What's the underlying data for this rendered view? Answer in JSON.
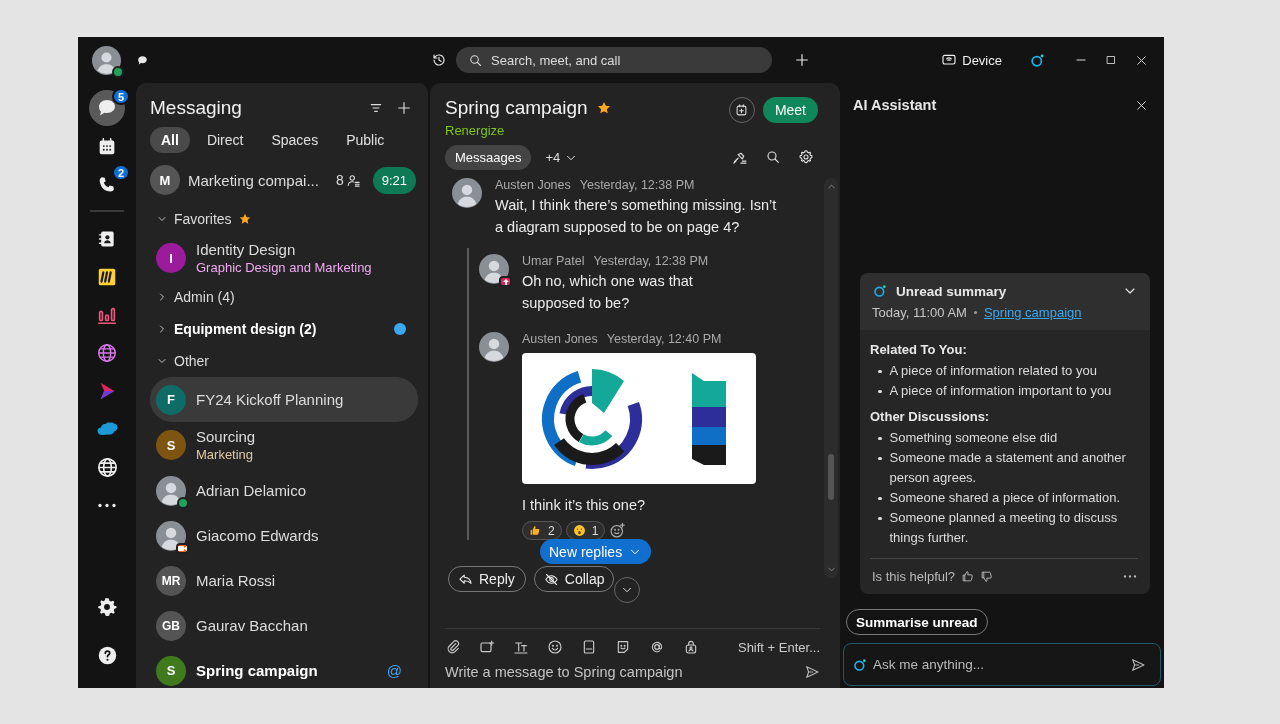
{
  "top_bar": {
    "user": {
      "status": {
        "kind": "available"
      }
    },
    "search": {
      "placeholder": "Search, meet, and call"
    },
    "device": "Device"
  },
  "rail": {
    "items": [
      {
        "kind": "messaging",
        "badge": "5",
        "selected": true
      },
      {
        "kind": "calendar",
        "selected": false
      },
      {
        "kind": "calls",
        "badge": "2",
        "selected": false
      },
      {
        "kind": "divider"
      },
      {
        "kind": "contacts",
        "selected": false
      },
      {
        "kind": "whiteboard",
        "selected": false
      },
      {
        "kind": "analytics",
        "selected": false
      },
      {
        "kind": "web",
        "selected": false
      },
      {
        "kind": "play",
        "selected": false
      },
      {
        "kind": "cloud",
        "selected": false
      },
      {
        "kind": "globe",
        "selected": false
      },
      {
        "kind": "more",
        "selected": false
      }
    ],
    "bottom": [
      {
        "kind": "settings"
      },
      {
        "kind": "help"
      }
    ]
  },
  "messaging": {
    "title": "Messaging",
    "filters": [
      {
        "label": "All",
        "selected": true
      },
      {
        "label": "Direct",
        "selected": false
      },
      {
        "label": "Spaces",
        "selected": false
      },
      {
        "label": "Public",
        "selected": false
      }
    ],
    "pinned": {
      "initials": "M",
      "name": "Marketing compai...",
      "count": "8",
      "time": "9:21"
    },
    "sections": [
      {
        "label": "Favorites",
        "expanded": true,
        "starred": true,
        "unread": false,
        "items": [
          {
            "kind": "initials",
            "initials": "I",
            "color": "#9c1a9c",
            "name": "Identity Design",
            "subtitle": "Graphic Design and Marketing",
            "selected": false,
            "unread": false
          }
        ]
      },
      {
        "label": "Admin (4)",
        "expanded": false,
        "starred": false,
        "unread": false
      },
      {
        "label": "Equipment design (2)",
        "expanded": false,
        "starred": false,
        "unread": true
      },
      {
        "label": "Other",
        "expanded": true,
        "starred": false,
        "unread": false,
        "items": [
          {
            "kind": "initials",
            "initials": "F",
            "color": "#0f6b66",
            "name": "FY24 Kickoff Planning",
            "selected": true,
            "unread": false
          },
          {
            "kind": "initials",
            "initials": "S",
            "color": "#7d5410",
            "name": "Sourcing",
            "subtitle": "Marketing",
            "selected": false,
            "unread": false
          },
          {
            "kind": "photo",
            "name": "Adrian Delamico",
            "status": {
              "kind": "available"
            },
            "selected": false,
            "unread": false
          },
          {
            "kind": "photo",
            "name": "Giacomo Edwards",
            "status": {
              "kind": "meeting"
            },
            "selected": false,
            "unread": false
          },
          {
            "kind": "initials",
            "initials": "MR",
            "color": "#545454",
            "name": "Maria Rossi",
            "selected": false,
            "unread": false
          },
          {
            "kind": "initials",
            "initials": "GB",
            "color": "#545454",
            "name": "Gaurav Bacchan",
            "selected": false,
            "unread": false
          },
          {
            "kind": "initials",
            "initials": "S",
            "color": "#3f7a1c",
            "name": "Spring campaign",
            "selected": false,
            "unread": true,
            "mention": "@"
          }
        ]
      }
    ]
  },
  "chat": {
    "title": "Spring campaign",
    "starred": true,
    "subtitle": "Renergize",
    "meet": "Meet",
    "tabs": [
      {
        "label": "Messaages",
        "selected": true
      }
    ],
    "more_tabs": "+4",
    "messages": [
      {
        "author": "Austen Jones",
        "time": "Yesterday, 12:38 PM",
        "text": "Wait, I think there’s something missing. Isn’t a diagram supposed to be on page 4?",
        "replies": [
          {
            "author": "Umar Patel",
            "time": "Yesterday, 12:38 PM",
            "status": {
              "kind": "presenting"
            },
            "text": "Oh no, which one was that supposed to be?"
          },
          {
            "author": "Austen Jones",
            "time": "Yesterday, 12:40 PM",
            "attachment": {
              "kind": "diagram"
            },
            "text": "I think it’s this one?",
            "reactions": [
              {
                "kind": "thumbs-up",
                "count": "2"
              },
              {
                "kind": "surprised",
                "count": "1"
              }
            ]
          }
        ]
      }
    ],
    "reply": "Reply",
    "collapse": "Collap",
    "new_replies": "New replies",
    "composer": {
      "hint": "Shift + Enter...",
      "placeholder": "Write a message to Spring campaign"
    }
  },
  "ai_assistant": {
    "title": "AI Assistant",
    "summary": {
      "title": "Unread summary",
      "expanded": true,
      "time": "Today, 11:00 AM",
      "link": "Spring campaign",
      "sections": [
        {
          "heading": "Related To You:",
          "bullets": [
            "A piece of information related to you",
            "A piece of information important to you"
          ]
        },
        {
          "heading": "Other Discussions:",
          "bullets": [
            "Something someone else did",
            "Someone made a statement and another person agrees.",
            "Someone shared a piece of information.",
            "Someone planned a meeting to discuss things further."
          ]
        }
      ],
      "feedback": "Is this helpful?"
    },
    "suggestion": "Summarise unread",
    "input": {
      "placeholder": "Ask me anything..."
    }
  }
}
